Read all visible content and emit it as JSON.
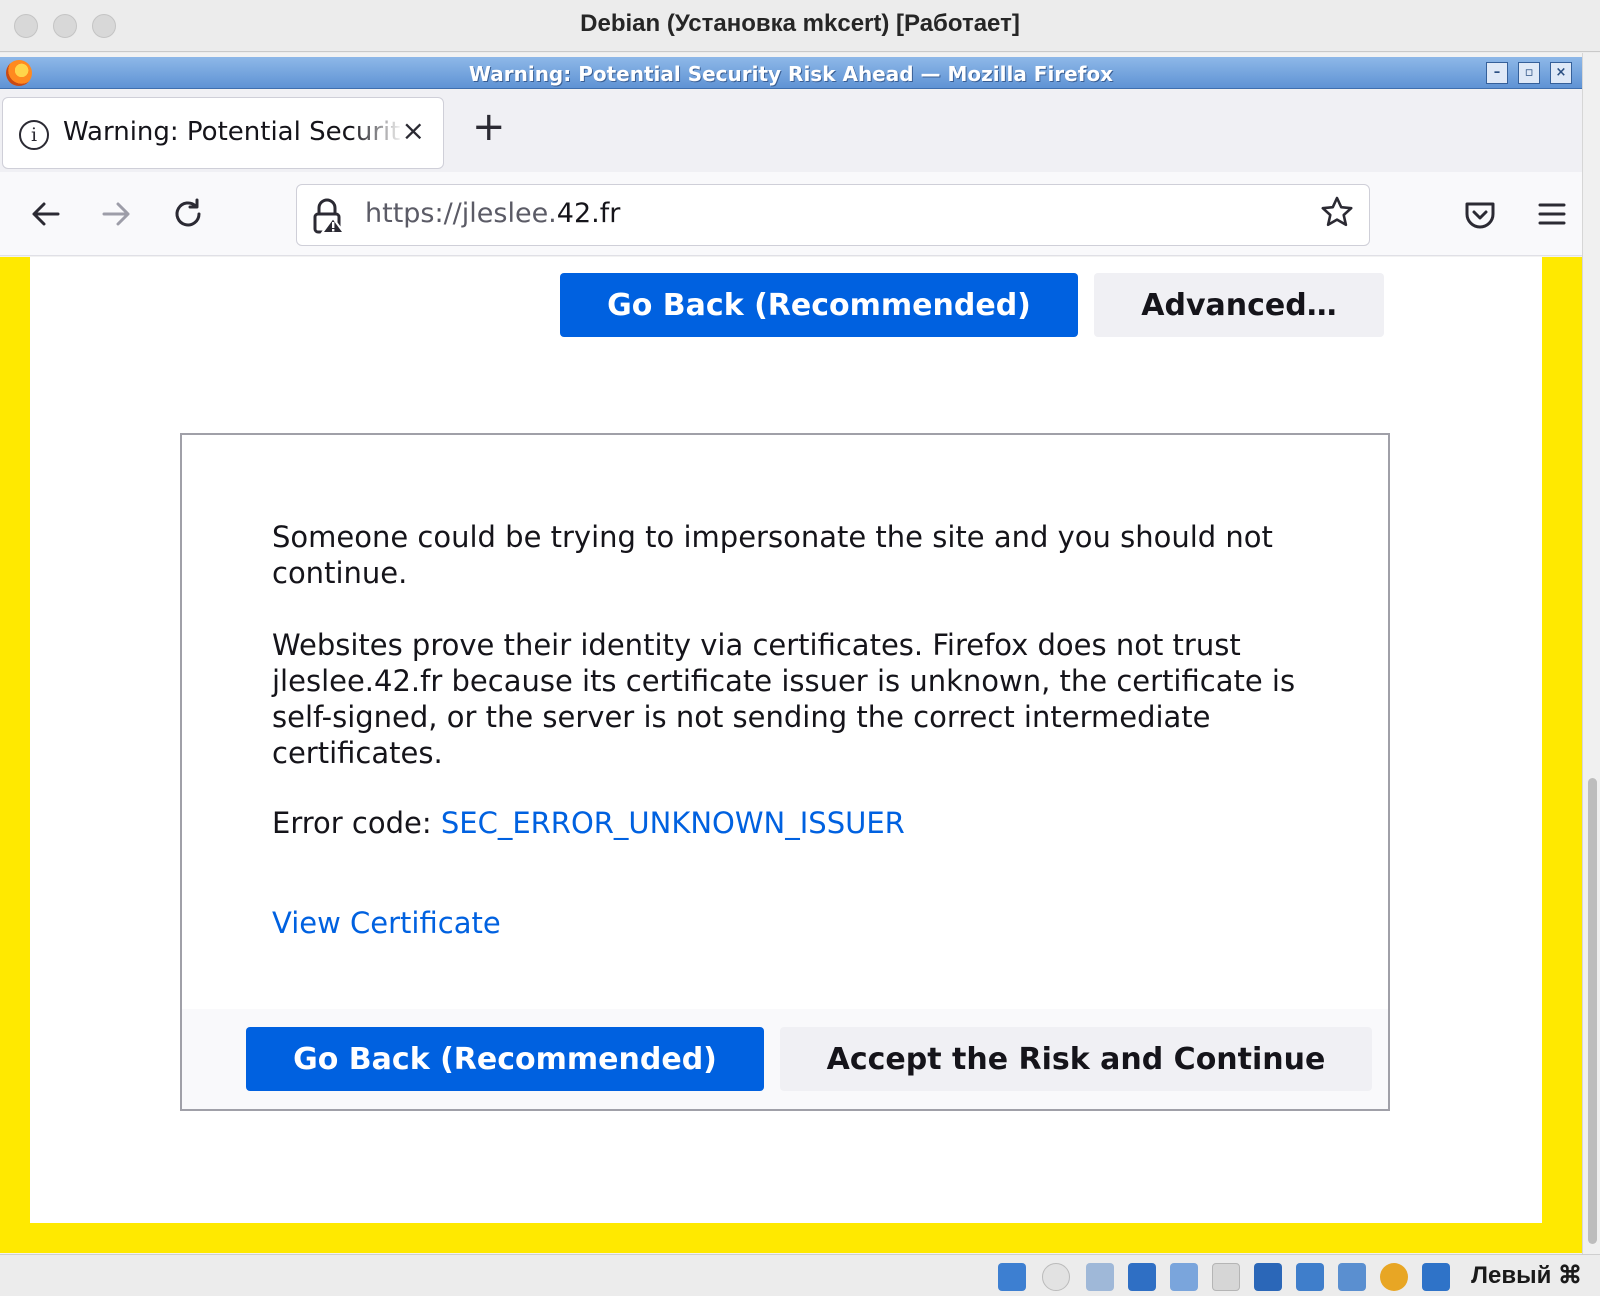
{
  "host_window": {
    "title": "Debian (Установка mkcert) [Работает]"
  },
  "wm_window": {
    "title": "Warning: Potential Security Risk Ahead — Mozilla Firefox"
  },
  "browser": {
    "tab": {
      "title": "Warning: Potential Security Risk Ahead",
      "close_glyph": "×"
    },
    "new_tab_glyph": "+",
    "urlbar": {
      "scheme_prefix": "https://jleslee.",
      "host_suffix": "42.fr"
    }
  },
  "page": {
    "top_go_back_label": "Go Back (Recommended)",
    "advanced_label": "Advanced…",
    "panel": {
      "paragraph_1": "Someone could be trying to impersonate the site and you should not continue.",
      "paragraph_2": "Websites prove their identity via certificates. Firefox does not trust jleslee.42.fr because its certificate issuer is unknown, the certificate is self-signed, or the server is not sending the correct intermediate certificates.",
      "error_code_label": "Error code: ",
      "error_code_value": "SEC_ERROR_UNKNOWN_ISSUER",
      "view_certificate_label": "View Certificate",
      "go_back_label": "Go Back (Recommended)",
      "accept_risk_label": "Accept the Risk and Continue"
    }
  },
  "vbox_status": {
    "host_key_label": "Левый ⌘"
  },
  "colors": {
    "primary_button": "#0061e0",
    "link": "#0061e0",
    "warning_border": "#ffe900"
  }
}
